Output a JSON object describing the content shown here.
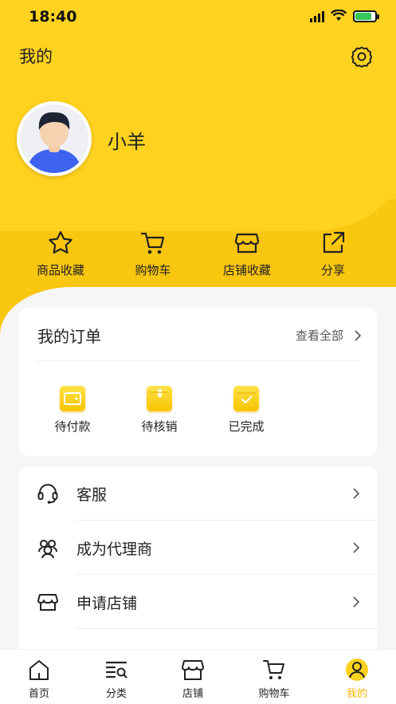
{
  "status": {
    "time": "18:40"
  },
  "header": {
    "title": "我的"
  },
  "profile": {
    "name": "小羊"
  },
  "quick_actions": [
    {
      "label": "商品收藏",
      "icon": "star-icon"
    },
    {
      "label": "购物车",
      "icon": "cart-icon"
    },
    {
      "label": "店铺收藏",
      "icon": "store-icon"
    },
    {
      "label": "分享",
      "icon": "share-icon"
    }
  ],
  "orders": {
    "title": "我的订单",
    "view_all": "查看全部",
    "items": [
      {
        "label": "待付款",
        "icon": "wallet-icon"
      },
      {
        "label": "待核销",
        "icon": "box-icon"
      },
      {
        "label": "已完成",
        "icon": "completed-box-icon"
      }
    ]
  },
  "menu": [
    {
      "label": "客服",
      "icon": "headset-icon"
    },
    {
      "label": "成为代理商",
      "icon": "agent-icon"
    },
    {
      "label": "申请店铺",
      "icon": "store-icon"
    }
  ],
  "tabbar": [
    {
      "label": "首页",
      "icon": "home-icon"
    },
    {
      "label": "分类",
      "icon": "category-icon"
    },
    {
      "label": "店铺",
      "icon": "store-icon"
    },
    {
      "label": "购物车",
      "icon": "cart-icon"
    },
    {
      "label": "我的",
      "icon": "profile-icon"
    }
  ],
  "colors": {
    "accent": "#ffd21f",
    "accent_dark": "#f9c610",
    "active_tab": "#f5b800"
  }
}
